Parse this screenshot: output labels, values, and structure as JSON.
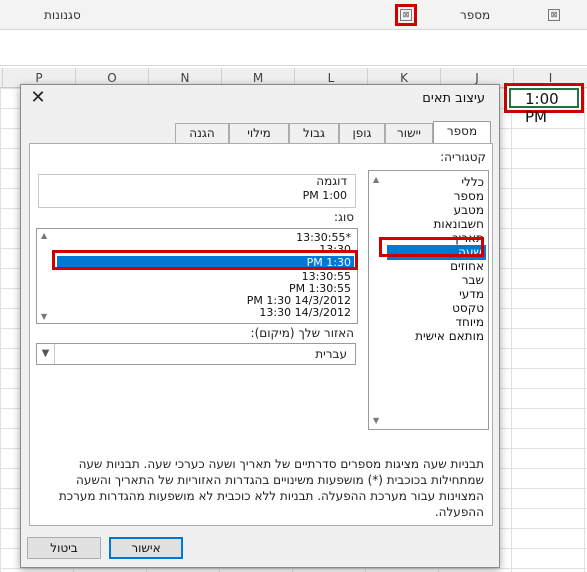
{
  "ribbon": {
    "group_styles": "סגנונות",
    "group_number": "מספר",
    "launcher_symbol": "⊠"
  },
  "columns": [
    "P",
    "O",
    "N",
    "M",
    "L",
    "K",
    "J",
    "I"
  ],
  "active_cell": {
    "value": "1:00 PM"
  },
  "dialog": {
    "title": "עיצוב תאים",
    "close_symbol": "✕",
    "tabs": [
      "מספר",
      "יישור",
      "גופן",
      "גבול",
      "מילוי",
      "הגנה"
    ],
    "category_label": "קטגוריה:",
    "categories": [
      "כללי",
      "מספר",
      "מטבע",
      "חשבונאות",
      "תאריך",
      "שעה",
      "אחוזים",
      "שבר",
      "מדעי",
      "טקסט",
      "מיוחד",
      "מותאם אישית"
    ],
    "selected_category": "שעה",
    "sample_label": "דוגמה",
    "sample_value": "PM 1:00",
    "type_label": "סוג:",
    "types": [
      "13:30:55*",
      "13:30",
      "PM 1:30",
      "13:30:55",
      "PM 1:30:55",
      "PM 1:30 14/3/2012",
      "13:30 14/3/2012"
    ],
    "selected_type": "PM 1:30",
    "locale_label": "האזור שלך (מיקום):",
    "locale_value": "עברית",
    "description_lines": [
      "תבניות שעה מציגות מספרים סדרתיים של תאריך ושעה כערכי שעה.  תבניות שעה",
      "שמתחילות בכוכבית (*) מושפעות משינויים בהגדרות האזוריות של התאריך והשעה",
      "המצוינות עבור מערכת ההפעלה. תבניות ללא כוכבית לא מושפעות מהגדרות מערכת",
      "ההפעלה."
    ],
    "ok_label": "אישור",
    "cancel_label": "ביטול"
  },
  "colors": {
    "highlight": "#d00000",
    "selection": "#0078d7",
    "cell_border": "#217346"
  }
}
